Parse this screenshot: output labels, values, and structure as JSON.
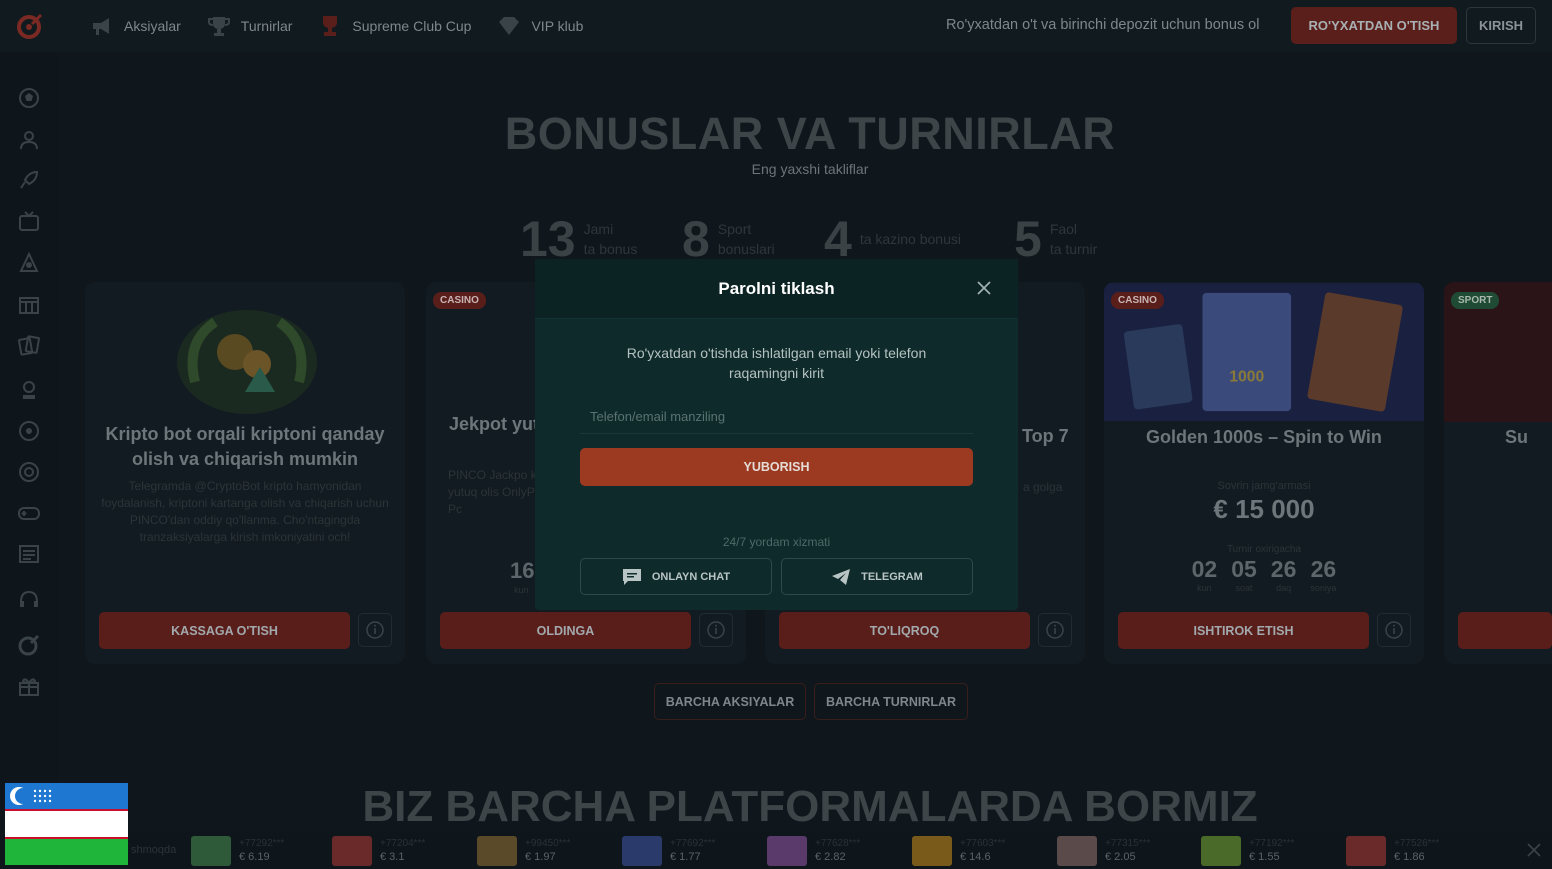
{
  "topbar": {
    "nav": [
      {
        "label": "Aksiyalar",
        "icon": "megaphone-icon"
      },
      {
        "label": "Turnirlar",
        "icon": "trophy-icon"
      },
      {
        "label": "Supreme Club Cup",
        "icon": "cup-icon"
      },
      {
        "label": "VIP klub",
        "icon": "diamond-icon"
      }
    ],
    "promo": "Ro'yxatdan o't va birinchi depozit uchun bonus ol",
    "register_label": "RO'YXATDAN O'TISH",
    "login_label": "KIRISH"
  },
  "hero": {
    "title": "BONUSLAR VA TURNIRLAR",
    "subtitle": "Eng yaxshi takliflar"
  },
  "stats": [
    {
      "num": "13",
      "line1": "Jami",
      "line2": "ta bonus"
    },
    {
      "num": "8",
      "line1": "Sport",
      "line2": "bonuslari"
    },
    {
      "num": "4",
      "line1": "",
      "line2": "ta kazino bonusi"
    },
    {
      "num": "5",
      "line1": "Faol",
      "line2": "ta turnir"
    }
  ],
  "cards": [
    {
      "title": "Kripto bot orqali kriptoni qanday olish va chiqarish mumkin",
      "desc": "Telegramda @CryptoBot kripto hamyonidan foydalanish, kriptoni kartanga olish va chiqarish uchun PINCO'dan oddiy qo'llanma. Cho'ntagingda tranzaksiyalarga kirish imkoniyatini och!",
      "button": "KASSAGA O'TISH"
    },
    {
      "badge": "CASINO",
      "title": "Jekpot yut",
      "desc": "PINCO Jackpo katta yutuq olis OnlyPlay, Pc",
      "counter": "16",
      "counter_unit": "kun",
      "button": "OLDINGA"
    },
    {
      "title": "Top 7",
      "desc": "a golga",
      "button": "TO'LIQROQ"
    },
    {
      "badge": "CASINO",
      "title": "Golden 1000s – Spin to Win",
      "prize_label": "Sovrin jamg'armasi",
      "prize": "€ 15 000",
      "timer_label": "Turnir oxirigacha",
      "timer": [
        {
          "value": "02",
          "unit": "kun"
        },
        {
          "value": "05",
          "unit": "soat"
        },
        {
          "value": "26",
          "unit": "daq"
        },
        {
          "value": "26",
          "unit": "soniya"
        }
      ],
      "button": "ISHTIROK ETISH"
    },
    {
      "badge": "SPORT",
      "title": "Su"
    }
  ],
  "all_buttons": {
    "promos": "BARCHA AKSIYALAR",
    "tournaments": "BARCHA TURNIRLAR"
  },
  "platform_title": "BIZ BARCHA PLATFORMALARDA BORMIZ",
  "ticker": {
    "label": "shmoqda",
    "wins": [
      {
        "user": "+77292***",
        "amount": "€ 6.19",
        "color": "#2e5a3a"
      },
      {
        "user": "+77204***",
        "amount": "€ 3.1",
        "color": "#6a2a2a"
      },
      {
        "user": "+99450***",
        "amount": "€ 1.97",
        "color": "#5a4a2a"
      },
      {
        "user": "+77692***",
        "amount": "€ 1.77",
        "color": "#2a3a6a"
      },
      {
        "user": "+77628***",
        "amount": "€ 2.82",
        "color": "#5a3a6a"
      },
      {
        "user": "+77603***",
        "amount": "€ 14.6",
        "color": "#7a5a1a"
      },
      {
        "user": "+77315***",
        "amount": "€ 2.05",
        "color": "#5a4a4a"
      },
      {
        "user": "+77192***",
        "amount": "€ 1.55",
        "color": "#4a6a2a"
      },
      {
        "user": "+77526***",
        "amount": "€ 1.86",
        "color": "#6a2a2a"
      }
    ]
  },
  "modal": {
    "title": "Parolni tiklash",
    "text": "Ro'yxatdan o'tishda ishlatilgan email yoki telefon raqamingni kirit",
    "input_placeholder": "Telefon/email manziling",
    "input_value": "",
    "submit_label": "YUBORISH",
    "support_label": "24/7 yordam xizmati",
    "chat_label": "ONLAYN CHAT",
    "telegram_label": "TELEGRAM"
  },
  "colors": {
    "accent": "#9c3a21",
    "modal_bg": "#0f2a2a",
    "page_bg": "#0f171c"
  }
}
